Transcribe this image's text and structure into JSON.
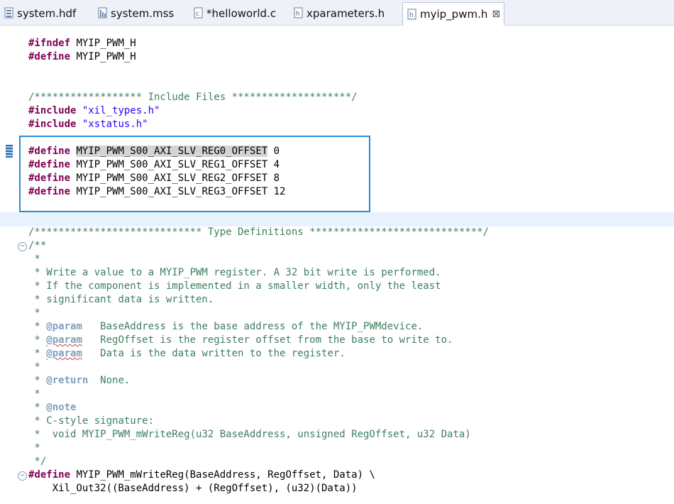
{
  "tabs": [
    {
      "label": "system.hdf",
      "icon": "hardware-file-icon"
    },
    {
      "label": "system.mss",
      "icon": "settings-file-icon"
    },
    {
      "label": "*helloworld.c",
      "icon": "c-source-file-icon"
    },
    {
      "label": "xparameters.h",
      "icon": "header-file-icon"
    },
    {
      "label": "myip_pwm.h",
      "icon": "header-file-icon",
      "close": "⊠"
    }
  ],
  "code": {
    "ifndef_kw": "#ifndef",
    "ifndef_name": " MYIP_PWM_H",
    "define_kw": "#define",
    "define_name": " MYIP_PWM_H",
    "include_comment": "/****************** Include Files ********************/",
    "include_kw": "#include",
    "include_1": "\"xil_types.h\"",
    "include_2": "\"xstatus.h\"",
    "reg_defines": [
      {
        "name": "MYIP_PWM_S00_AXI_SLV_REG0_OFFSET",
        "value": " 0"
      },
      {
        "name": "MYIP_PWM_S00_AXI_SLV_REG1_OFFSET",
        "value": " 4"
      },
      {
        "name": "MYIP_PWM_S00_AXI_SLV_REG2_OFFSET",
        "value": " 8"
      },
      {
        "name": "MYIP_PWM_S00_AXI_SLV_REG3_OFFSET",
        "value": " 12"
      }
    ],
    "type_def_comment": "/**************************** Type Definitions *****************************/",
    "doc": [
      "/**",
      " *",
      " * Write a value to a MYIP_PWM register. A 32 bit write is performed.",
      " * If the component is implemented in a smaller width, only the least",
      " * significant data is written.",
      " *"
    ],
    "param_tag": "@param",
    "params": [
      "   BaseAddress is the base address of the MYIP_PWMdevice.",
      "   RegOffset is the register offset from the base to write to.",
      "   Data is the data written to the register."
    ],
    "star": " * ",
    "star_line": " *",
    "return_tag": "@return",
    "return_text": "  None.",
    "note_tag": "@note",
    "note_1": " * C-style signature:",
    "note_2": " *  void MYIP_PWM_mWriteReg(u32 BaseAddress, unsigned RegOffset, u32 Data)",
    "doc_end": " */",
    "macro_name": " MYIP_PWM_mWriteReg(BaseAddress, RegOffset, Data) \\",
    "macro_body": "    Xil_Out32((BaseAddress) + (RegOffset), (u32)(Data))"
  }
}
